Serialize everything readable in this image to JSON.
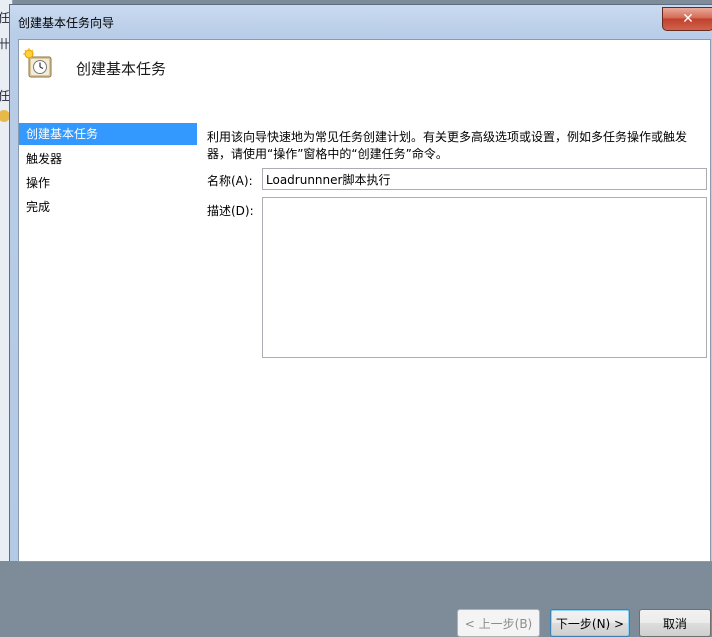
{
  "window": {
    "title": "创建基本任务向导",
    "close_glyph": "✕"
  },
  "background_app": {
    "glyphs": [
      "任",
      "卄",
      "任"
    ]
  },
  "header": {
    "title": "创建基本任务",
    "icon": "scheduled-task-clock-icon"
  },
  "sidebar": {
    "items": [
      {
        "label": "创建基本任务",
        "active": true
      },
      {
        "label": "触发器",
        "active": false
      },
      {
        "label": "操作",
        "active": false
      },
      {
        "label": "完成",
        "active": false
      }
    ]
  },
  "main": {
    "description": "利用该向导快速地为常见任务创建计划。有关更多高级选项或设置，例如多任务操作或触发器，请使用“操作”窗格中的“创建任务”命令。",
    "name_label": "名称(A):",
    "name_value": "Loadrunnner脚本执行",
    "desc_label": "描述(D):",
    "desc_value": ""
  },
  "buttons": {
    "back": "< 上一步(B)",
    "next": "下一步(N) >",
    "cancel": "取消"
  },
  "colors": {
    "selection": "#3399ff",
    "close_button": "#c0412c"
  }
}
